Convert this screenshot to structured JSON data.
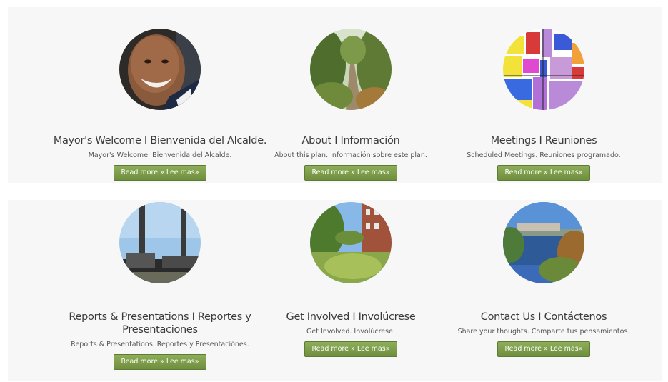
{
  "cards": [
    {
      "title": "Mayor's Welcome I Bienvenida del Alcalde.",
      "desc": "Mayor's Welcome. Bienvenida del Alcalde.",
      "button": "Read more » Lee mas»"
    },
    {
      "title": "About I Información",
      "desc": "About this plan. Información sobre este plan.",
      "button": "Read more » Lee mas»"
    },
    {
      "title": "Meetings I Reuniones",
      "desc": "Scheduled Meetings. Reuniones programado.",
      "button": "Read more » Lee mas»"
    },
    {
      "title": "Reports & Presentations I Reportes y Presentaciones",
      "desc": "Reports & Presentations. Reportes y Presentaciónes.",
      "button": "Read more » Lee mas»"
    },
    {
      "title": "Get Involved I Involúcrese",
      "desc": "Get Involved. Involúcrese.",
      "button": "Read more » Lee mas»"
    },
    {
      "title": "Contact Us I Contáctenos",
      "desc": "Share your thoughts. Comparte tus pensamientos.",
      "button": "Read more » Lee mas»"
    }
  ],
  "colors": {
    "panel": "#f7f7f7",
    "button": "#7a9a48",
    "title": "#3a3a3a"
  }
}
